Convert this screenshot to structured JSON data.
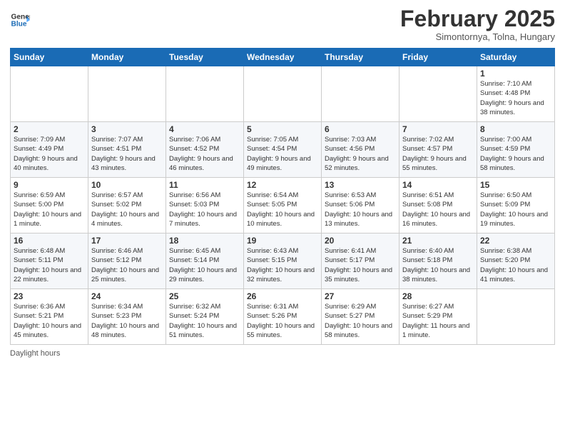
{
  "logo": {
    "line1": "General",
    "line2": "Blue"
  },
  "header": {
    "month": "February 2025",
    "location": "Simontornya, Tolna, Hungary"
  },
  "weekdays": [
    "Sunday",
    "Monday",
    "Tuesday",
    "Wednesday",
    "Thursday",
    "Friday",
    "Saturday"
  ],
  "weeks": [
    [
      {
        "day": "",
        "info": ""
      },
      {
        "day": "",
        "info": ""
      },
      {
        "day": "",
        "info": ""
      },
      {
        "day": "",
        "info": ""
      },
      {
        "day": "",
        "info": ""
      },
      {
        "day": "",
        "info": ""
      },
      {
        "day": "1",
        "info": "Sunrise: 7:10 AM\nSunset: 4:48 PM\nDaylight: 9 hours and 38 minutes."
      }
    ],
    [
      {
        "day": "2",
        "info": "Sunrise: 7:09 AM\nSunset: 4:49 PM\nDaylight: 9 hours and 40 minutes."
      },
      {
        "day": "3",
        "info": "Sunrise: 7:07 AM\nSunset: 4:51 PM\nDaylight: 9 hours and 43 minutes."
      },
      {
        "day": "4",
        "info": "Sunrise: 7:06 AM\nSunset: 4:52 PM\nDaylight: 9 hours and 46 minutes."
      },
      {
        "day": "5",
        "info": "Sunrise: 7:05 AM\nSunset: 4:54 PM\nDaylight: 9 hours and 49 minutes."
      },
      {
        "day": "6",
        "info": "Sunrise: 7:03 AM\nSunset: 4:56 PM\nDaylight: 9 hours and 52 minutes."
      },
      {
        "day": "7",
        "info": "Sunrise: 7:02 AM\nSunset: 4:57 PM\nDaylight: 9 hours and 55 minutes."
      },
      {
        "day": "8",
        "info": "Sunrise: 7:00 AM\nSunset: 4:59 PM\nDaylight: 9 hours and 58 minutes."
      }
    ],
    [
      {
        "day": "9",
        "info": "Sunrise: 6:59 AM\nSunset: 5:00 PM\nDaylight: 10 hours and 1 minute."
      },
      {
        "day": "10",
        "info": "Sunrise: 6:57 AM\nSunset: 5:02 PM\nDaylight: 10 hours and 4 minutes."
      },
      {
        "day": "11",
        "info": "Sunrise: 6:56 AM\nSunset: 5:03 PM\nDaylight: 10 hours and 7 minutes."
      },
      {
        "day": "12",
        "info": "Sunrise: 6:54 AM\nSunset: 5:05 PM\nDaylight: 10 hours and 10 minutes."
      },
      {
        "day": "13",
        "info": "Sunrise: 6:53 AM\nSunset: 5:06 PM\nDaylight: 10 hours and 13 minutes."
      },
      {
        "day": "14",
        "info": "Sunrise: 6:51 AM\nSunset: 5:08 PM\nDaylight: 10 hours and 16 minutes."
      },
      {
        "day": "15",
        "info": "Sunrise: 6:50 AM\nSunset: 5:09 PM\nDaylight: 10 hours and 19 minutes."
      }
    ],
    [
      {
        "day": "16",
        "info": "Sunrise: 6:48 AM\nSunset: 5:11 PM\nDaylight: 10 hours and 22 minutes."
      },
      {
        "day": "17",
        "info": "Sunrise: 6:46 AM\nSunset: 5:12 PM\nDaylight: 10 hours and 25 minutes."
      },
      {
        "day": "18",
        "info": "Sunrise: 6:45 AM\nSunset: 5:14 PM\nDaylight: 10 hours and 29 minutes."
      },
      {
        "day": "19",
        "info": "Sunrise: 6:43 AM\nSunset: 5:15 PM\nDaylight: 10 hours and 32 minutes."
      },
      {
        "day": "20",
        "info": "Sunrise: 6:41 AM\nSunset: 5:17 PM\nDaylight: 10 hours and 35 minutes."
      },
      {
        "day": "21",
        "info": "Sunrise: 6:40 AM\nSunset: 5:18 PM\nDaylight: 10 hours and 38 minutes."
      },
      {
        "day": "22",
        "info": "Sunrise: 6:38 AM\nSunset: 5:20 PM\nDaylight: 10 hours and 41 minutes."
      }
    ],
    [
      {
        "day": "23",
        "info": "Sunrise: 6:36 AM\nSunset: 5:21 PM\nDaylight: 10 hours and 45 minutes."
      },
      {
        "day": "24",
        "info": "Sunrise: 6:34 AM\nSunset: 5:23 PM\nDaylight: 10 hours and 48 minutes."
      },
      {
        "day": "25",
        "info": "Sunrise: 6:32 AM\nSunset: 5:24 PM\nDaylight: 10 hours and 51 minutes."
      },
      {
        "day": "26",
        "info": "Sunrise: 6:31 AM\nSunset: 5:26 PM\nDaylight: 10 hours and 55 minutes."
      },
      {
        "day": "27",
        "info": "Sunrise: 6:29 AM\nSunset: 5:27 PM\nDaylight: 10 hours and 58 minutes."
      },
      {
        "day": "28",
        "info": "Sunrise: 6:27 AM\nSunset: 5:29 PM\nDaylight: 11 hours and 1 minute."
      },
      {
        "day": "",
        "info": ""
      }
    ]
  ],
  "footer": {
    "daylight_label": "Daylight hours"
  }
}
